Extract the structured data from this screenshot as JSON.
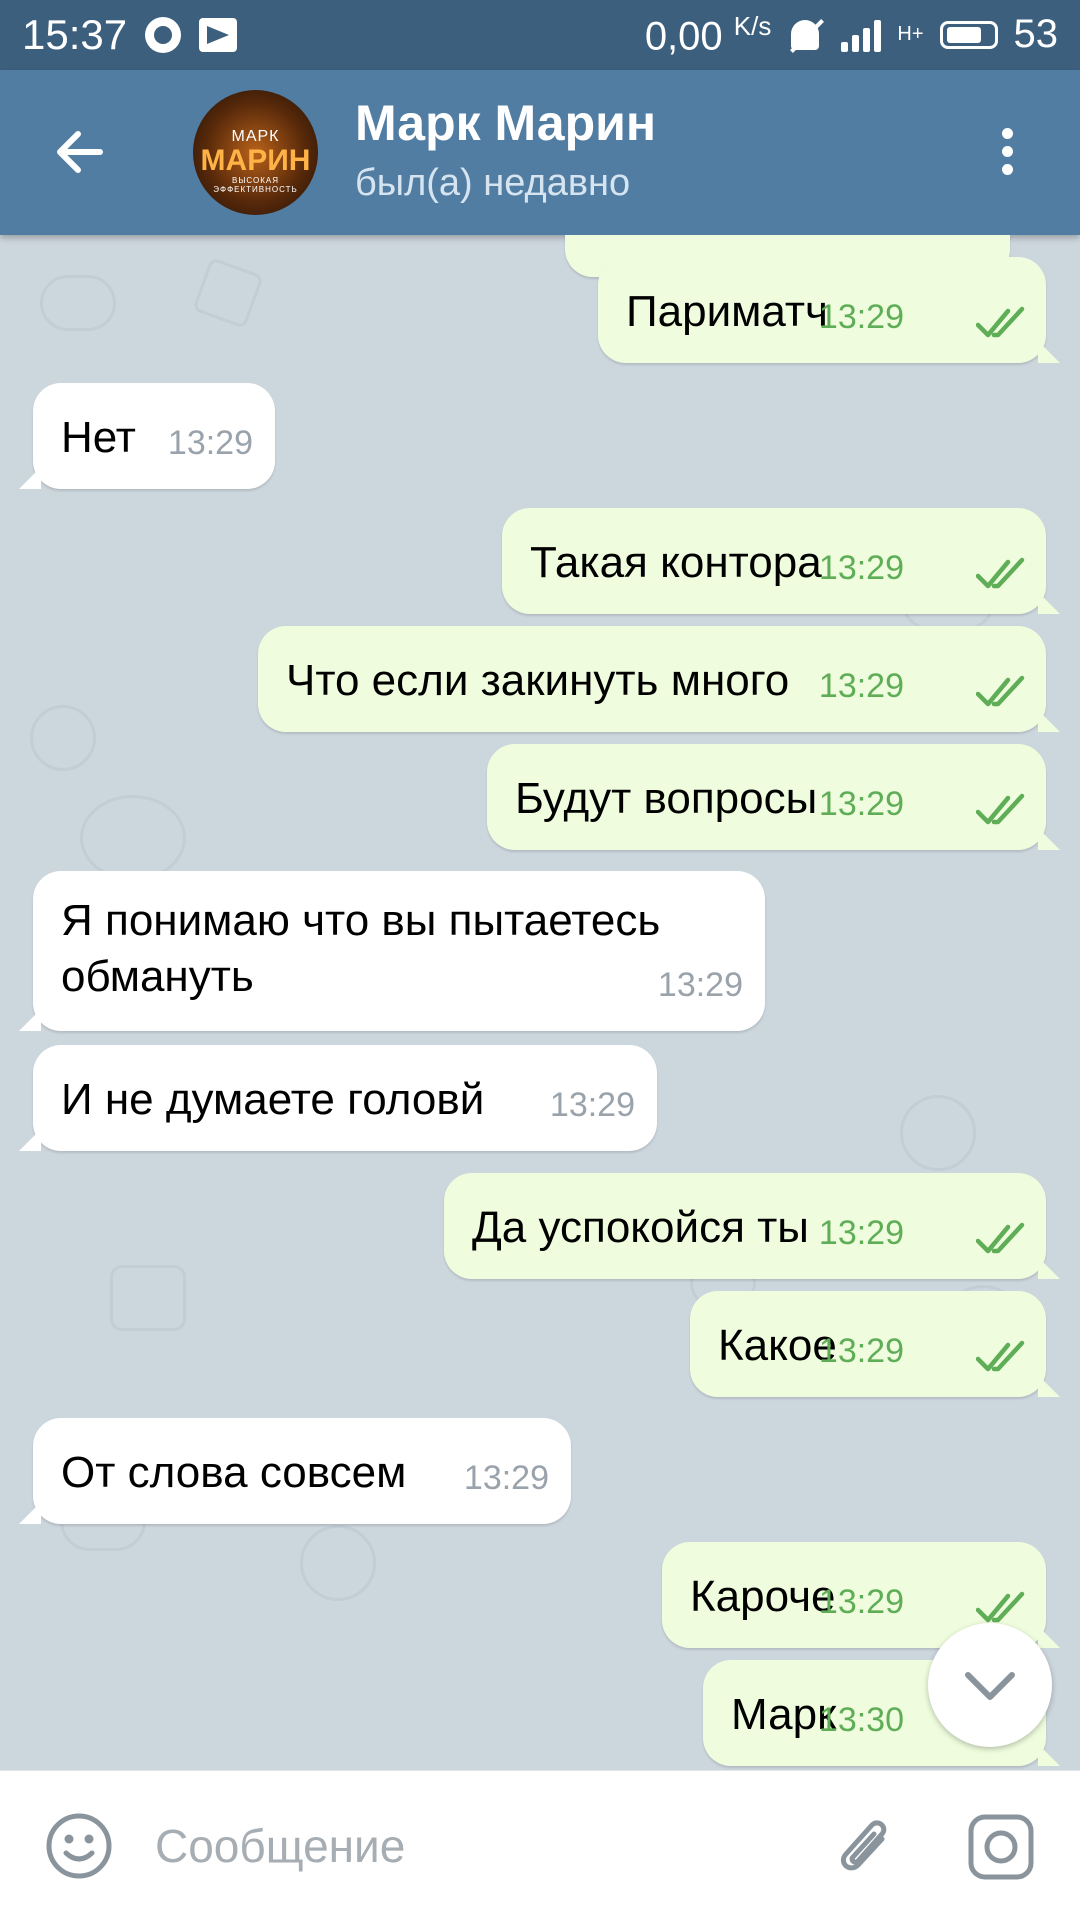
{
  "status_bar": {
    "time": "15:37",
    "speed": "0,00",
    "speed_unit": "K/s",
    "network": "H+",
    "battery": "53"
  },
  "header": {
    "title": "Марк Марин",
    "status": "был(а) недавно",
    "avatar_text": {
      "line1": "МАРК",
      "line2": "МАРИН",
      "line3": "ВЫСОКАЯ ЭФФЕКТИВНОСТЬ"
    }
  },
  "messages": [
    {
      "dir": "out",
      "text": "Париматч",
      "time": "13:29"
    },
    {
      "dir": "in",
      "text": "Нет",
      "time": "13:29"
    },
    {
      "dir": "out",
      "text": "Такая контора",
      "time": "13:29"
    },
    {
      "dir": "out",
      "text": "Что если закинуть много",
      "time": "13:29"
    },
    {
      "dir": "out",
      "text": "Будут вопросы",
      "time": "13:29"
    },
    {
      "dir": "in",
      "text": "Я понимаю что вы пытаетесь обмануть",
      "time": "13:29"
    },
    {
      "dir": "in",
      "text": "И не думаете головй",
      "time": "13:29"
    },
    {
      "dir": "out",
      "text": "Да успокойся ты",
      "time": "13:29"
    },
    {
      "dir": "out",
      "text": "Какое",
      "time": "13:29"
    },
    {
      "dir": "in",
      "text": "От слова совсем",
      "time": "13:29"
    },
    {
      "dir": "out",
      "text": "Кароче",
      "time": "13:29"
    },
    {
      "dir": "out",
      "text": "Марк",
      "time": "13:30"
    }
  ],
  "input": {
    "placeholder": "Сообщение",
    "value": ""
  },
  "colors": {
    "header": "#527da3",
    "status_bar": "#3d5f7e",
    "outgoing_bubble": "#effdde",
    "incoming_bubble": "#ffffff",
    "read_ticks": "#5fae57",
    "chat_background": "#ccd6dd"
  },
  "icons": {
    "back": "arrow-left-icon",
    "menu": "more-vertical-icon",
    "emoji": "smile-icon",
    "attach": "paperclip-icon",
    "camera": "camera-icon",
    "scroll": "chevron-down-icon"
  }
}
